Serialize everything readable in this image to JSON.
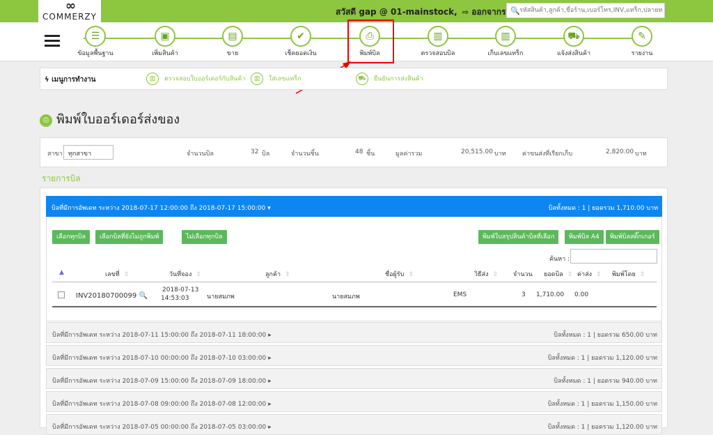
{
  "header": {
    "logo_mark": "∞",
    "logo_text": "COMMERZY",
    "greeting": "สวัสดี gap @ 01-mainstock,",
    "logout": "ออกจากระบบ",
    "search_placeholder": "รหัสสินค้า,ลูกค้า,ชื่อร้าน,เบอร์โทร,INV,แทร็ก,ปลายทาง"
  },
  "nav": {
    "items": [
      {
        "label": "ข้อมูลพื้นฐาน",
        "icon": "database-icon"
      },
      {
        "label": "เพิ่มสินค้า",
        "icon": "box-icon"
      },
      {
        "label": "ขาย",
        "icon": "cash-register-icon"
      },
      {
        "label": "เช็คยอดเงิน",
        "icon": "money-check-icon"
      },
      {
        "label": "พิมพ์บิล",
        "icon": "printer-icon"
      },
      {
        "label": "ตรวจสอบบิล",
        "icon": "barcode-scan-icon"
      },
      {
        "label": "เก็บเลขแทร็ก",
        "icon": "barcode-scan-icon"
      },
      {
        "label": "แจ้งส่งสินค้า",
        "icon": "truck-icon"
      },
      {
        "label": "รายงาน",
        "icon": "report-icon"
      }
    ]
  },
  "menu": {
    "title": "เมนูการทำงาน",
    "links": [
      "ตรวจสอบใบออร์เดอร์กับสินค้า",
      "ใส่เลขแทร็ก",
      "ยืนยันการส่งสินค้า"
    ]
  },
  "page": {
    "title": "พิมพ์ใบออร์เดอร์ส่งของ",
    "section": "รายการบิล"
  },
  "summary": {
    "branch_label": "สาขา",
    "branch_value": "ทุกสาขา",
    "bills_label": "จำนวนบิล",
    "bills_value": "32",
    "bills_unit": "บิล",
    "items_label": "จำนวนชิ้น",
    "items_value": "48",
    "items_unit": "ชิ้น",
    "total_label": "มูลค่ารวม",
    "total_value": "20,515.00",
    "total_unit": "บาท",
    "ship_label": "ค่าขนส่งที่เรียกเก็บ",
    "ship_value": "2,820.00",
    "ship_unit": "บาท"
  },
  "active_group": {
    "range": "บิลที่มีการอัพเดท ระหว่าง 2018-07-17 12:00:00 ถึง 2018-07-17 15:00:00",
    "summary": "บิลทั้งหมด : 1 | ยอดรวม 1,710.00 บาท",
    "buttons": {
      "select_all": "เลือกทุกบิล",
      "select_unprinted": "เลือกบิลที่ยังไม่ถูกพิมพ์",
      "deselect_all": "ไม่เลือกทุกบิล",
      "print_summary": "พิมพ์ใบสรุปสินค้าบิลที่เลือก",
      "print_a4": "พิมพ์บิล A4",
      "print_sticker": "พิมพ์บิลสติ๊กเกอร์"
    },
    "search_label": "ค้นหา :",
    "columns": [
      "เลขที่",
      "วันที่จอง",
      "ลูกค้า",
      "ชื่อผู้รับ",
      "วิธีส่ง",
      "จำนวน",
      "ยอดบิล",
      "ค่าส่ง",
      "พิมพ์โดย"
    ],
    "row": {
      "invoice": "INV20180700099",
      "date": "2018-07-13",
      "time": "14:53:03",
      "customer": "นายสมภพ",
      "receiver": "นายสมภพ",
      "method": "EMS",
      "qty": "3",
      "amount": "1,710.00",
      "shipping": "0.00",
      "printed_by": ""
    }
  },
  "groups": [
    {
      "range": "บิลที่มีการอัพเดท ระหว่าง 2018-07-11 15:00:00 ถึง 2018-07-11 18:00:00",
      "summary": "บิลทั้งหมด : 1 | ยอดรวม 650.00 บาท"
    },
    {
      "range": "บิลที่มีการอัพเดท ระหว่าง 2018-07-10 00:00:00 ถึง 2018-07-10 03:00:00",
      "summary": "บิลทั้งหมด : 1 | ยอดรวม 1,120.00 บาท"
    },
    {
      "range": "บิลที่มีการอัพเดท ระหว่าง 2018-07-09 15:00:00 ถึง 2018-07-09 18:00:00",
      "summary": "บิลทั้งหมด : 1 | ยอดรวม 940.00 บาท"
    },
    {
      "range": "บิลที่มีการอัพเดท ระหว่าง 2018-07-08 09:00:00 ถึง 2018-07-08 12:00:00",
      "summary": "บิลทั้งหมด : 1 | ยอดรวม 1,150.00 บาท"
    },
    {
      "range": "บิลที่มีการอัพเดท ระหว่าง 2018-07-05 00:00:00 ถึง 2018-07-05 03:00:00",
      "summary": "บิลทั้งหมด : 1 | ยอดรวม 1,120.00 บาท"
    }
  ],
  "colors": {
    "brand_green": "#8dc63f",
    "active_blue": "#0d86f2",
    "button_green": "#5cb85c",
    "annotation_red": "#ee0000"
  }
}
